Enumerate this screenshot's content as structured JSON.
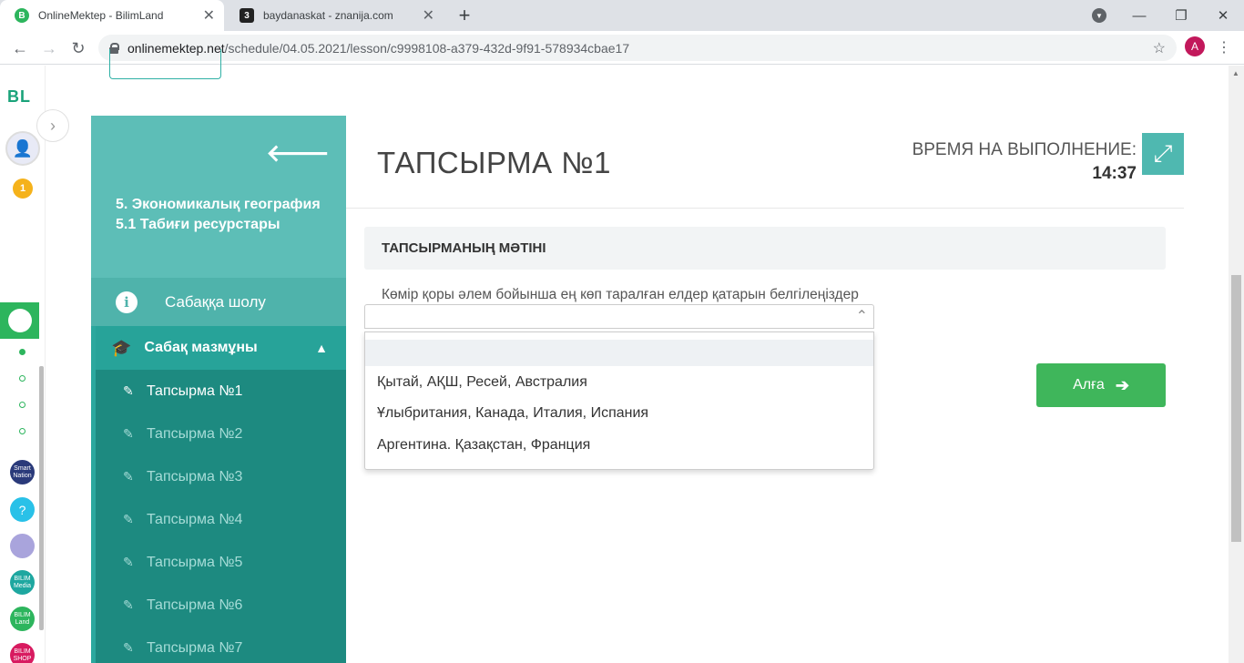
{
  "browser": {
    "tabs": [
      {
        "title": "OnlineMektep - BilimLand",
        "favicon": "B",
        "active": true
      },
      {
        "title": "baydanaskat - znanija.com",
        "favicon": "3",
        "active": false
      }
    ],
    "new_tab": "+",
    "url_host": "onlinemektep.net",
    "url_path": "/schedule/04.05.2021/lesson/c9998108-a379-432d-9f91-578934cbae17",
    "profile_initial": "A"
  },
  "rail": {
    "logo": "BL",
    "coins": "1",
    "apps": [
      "Smart Nation",
      "?",
      "",
      "BILIM Media",
      "BILIM Land",
      "BILIM SHOP"
    ]
  },
  "sidebar": {
    "lesson_title": "5. Экономикалық география 5.1 Табиғи ресурстары",
    "overview_label": "Сабаққа шолу",
    "content_label": "Сабақ мазмұны",
    "tasks": [
      "Тапсырма №1",
      "Тапсырма №2",
      "Тапсырма №3",
      "Тапсырма №4",
      "Тапсырма №5",
      "Тапсырма №6",
      "Тапсырма №7"
    ]
  },
  "main": {
    "task_title": "ТАПСЫРМА №1",
    "time_label": "ВРЕМЯ НА ВЫПОЛНЕНИЕ:",
    "time_value": "14:37",
    "text_heading": "ТАПСЫРМАНЫҢ МӘТІНІ",
    "question": "Көмір қоры әлем бойынша ең көп таралған елдер қатарын белгілеңіздер",
    "select_value": "",
    "options": [
      "",
      "Қытай, АҚШ, Ресей, Австралия",
      "Ұлыбритания, Канада, Италия, Испания",
      "Аргентина. Қазақстан, Франция"
    ],
    "next_label": "Алға"
  },
  "colors": {
    "sidebar_dark": "#1d8a80",
    "sidebar_light": "#5dbeb7",
    "next_button": "#3fb65b",
    "fullscreen_button": "#4fb8b0"
  }
}
